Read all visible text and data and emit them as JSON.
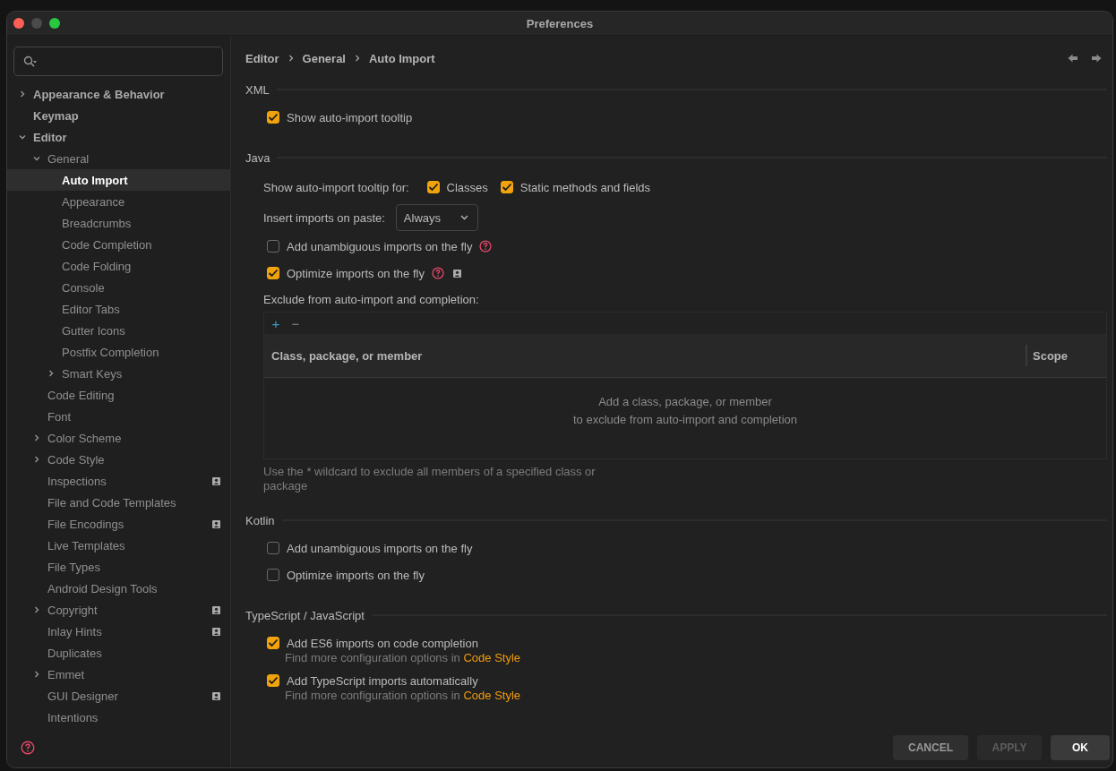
{
  "window": {
    "title": "Preferences"
  },
  "sidebar": {
    "items": [
      {
        "label": "Appearance & Behavior",
        "expanded": false,
        "selected": false
      },
      {
        "label": "Keymap",
        "selected": false
      },
      {
        "label": "Editor",
        "expanded": true,
        "selected": false,
        "children": [
          {
            "label": "General",
            "expanded": true,
            "selected": false,
            "children": [
              {
                "label": "Auto Import",
                "selected": true
              },
              {
                "label": "Appearance",
                "selected": false
              },
              {
                "label": "Breadcrumbs",
                "selected": false
              },
              {
                "label": "Code Completion",
                "selected": false
              },
              {
                "label": "Code Folding",
                "selected": false
              },
              {
                "label": "Console",
                "selected": false
              },
              {
                "label": "Editor Tabs",
                "selected": false
              },
              {
                "label": "Gutter Icons",
                "selected": false
              },
              {
                "label": "Postfix Completion",
                "selected": false
              },
              {
                "label": "Smart Keys",
                "expanded": false,
                "selected": false
              }
            ]
          },
          {
            "label": "Code Editing",
            "selected": false
          },
          {
            "label": "Font",
            "selected": false
          },
          {
            "label": "Color Scheme",
            "expanded": false,
            "selected": false
          },
          {
            "label": "Code Style",
            "expanded": false,
            "selected": false
          },
          {
            "label": "Inspections",
            "selected": false,
            "project_icon": true
          },
          {
            "label": "File and Code Templates",
            "selected": false
          },
          {
            "label": "File Encodings",
            "selected": false,
            "project_icon": true
          },
          {
            "label": "Live Templates",
            "selected": false
          },
          {
            "label": "File Types",
            "selected": false
          },
          {
            "label": "Android Design Tools",
            "selected": false
          },
          {
            "label": "Copyright",
            "expanded": false,
            "selected": false,
            "project_icon": true
          },
          {
            "label": "Inlay Hints",
            "selected": false,
            "project_icon": true
          },
          {
            "label": "Duplicates",
            "selected": false
          },
          {
            "label": "Emmet",
            "expanded": false,
            "selected": false
          },
          {
            "label": "GUI Designer",
            "selected": false,
            "project_icon": true
          },
          {
            "label": "Intentions",
            "selected": false
          }
        ]
      }
    ]
  },
  "breadcrumb": [
    "Editor",
    "General",
    "Auto Import"
  ],
  "sections": [
    {
      "title": "XML",
      "rows": [
        {
          "kind": "checkbox",
          "label": "Show auto-import tooltip",
          "checked": true
        }
      ]
    },
    {
      "title": "Java",
      "rows": [
        {
          "kind": "checkgroup",
          "label": "Show auto-import tooltip for:",
          "options": [
            {
              "label": "Classes",
              "checked": true
            },
            {
              "label": "Static methods and fields",
              "checked": true
            }
          ]
        },
        {
          "kind": "dropdown",
          "label": "Insert imports on paste:",
          "value": "Always"
        },
        {
          "kind": "checkbox",
          "label": "Add unambiguous imports on the fly",
          "checked": false,
          "help": true
        },
        {
          "kind": "checkbox",
          "label": "Optimize imports on the fly",
          "checked": true,
          "help": true,
          "project_icon": true
        },
        {
          "kind": "label",
          "label": "Exclude from auto-import and completion:"
        },
        {
          "kind": "table",
          "add": "+",
          "remove": "−",
          "columns": [
            "Class, package, or member",
            "Scope"
          ],
          "empty": [
            "Add a class, package, or member",
            "to exclude from auto-import and completion"
          ]
        },
        {
          "kind": "note",
          "label": "Use the * wildcard to exclude all members of a specified class or package"
        }
      ]
    },
    {
      "title": "Kotlin",
      "rows": [
        {
          "kind": "checkbox",
          "label": "Add unambiguous imports on the fly",
          "checked": false
        },
        {
          "kind": "checkbox",
          "label": "Optimize imports on the fly",
          "checked": false
        }
      ]
    },
    {
      "title": "TypeScript / JavaScript",
      "rows": [
        {
          "kind": "checkbox",
          "label": "Add ES6 imports on code completion",
          "checked": true,
          "hint": "Find more configuration options in",
          "link": "Code Style"
        },
        {
          "kind": "checkbox",
          "label": "Add TypeScript imports automatically",
          "checked": true,
          "hint": "Find more configuration options in",
          "link": "Code Style"
        }
      ]
    }
  ],
  "buttons": [
    {
      "label": "CANCEL",
      "kind": "normal"
    },
    {
      "label": "APPLY",
      "kind": "disabled"
    },
    {
      "label": "OK",
      "kind": "default"
    }
  ]
}
